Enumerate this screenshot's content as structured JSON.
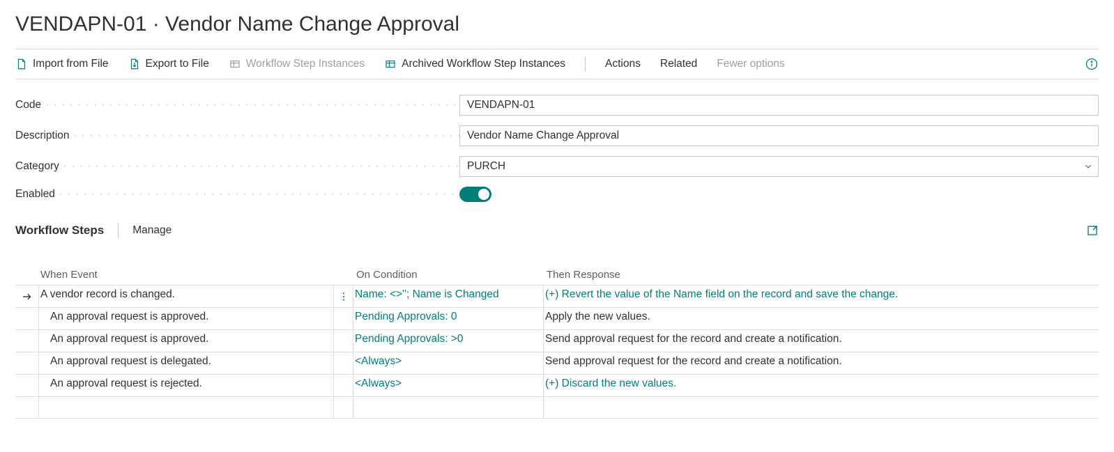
{
  "title": "VENDAPN-01 · Vendor Name Change Approval",
  "toolbar": {
    "importFromFile": "Import from File",
    "exportToFile": "Export to File",
    "workflowStepInstances": "Workflow Step Instances",
    "archivedWorkflowStepInstances": "Archived Workflow Step Instances",
    "actions": "Actions",
    "related": "Related",
    "fewerOptions": "Fewer options"
  },
  "form": {
    "codeLabel": "Code",
    "codeValue": "VENDAPN-01",
    "descriptionLabel": "Description",
    "descriptionValue": "Vendor Name Change Approval",
    "categoryLabel": "Category",
    "categoryValue": "PURCH",
    "enabledLabel": "Enabled",
    "enabledValue": true
  },
  "section": {
    "title": "Workflow Steps",
    "manage": "Manage"
  },
  "grid": {
    "headers": {
      "whenEvent": "When Event",
      "onCondition": "On Condition",
      "thenResponse": "Then Response"
    },
    "rows": [
      {
        "selected": true,
        "indent": 0,
        "event": "A vendor record is changed.",
        "condition": "Name: <>''; Name is Changed",
        "conditionLink": true,
        "response": "(+) Revert the value of the Name field on the record and save the change.",
        "responseLink": true,
        "showMore": true
      },
      {
        "selected": false,
        "indent": 1,
        "event": "An approval request is approved.",
        "condition": "Pending Approvals: 0",
        "conditionLink": true,
        "response": "Apply the new values.",
        "responseLink": false,
        "showMore": false
      },
      {
        "selected": false,
        "indent": 1,
        "event": "An approval request is approved.",
        "condition": "Pending Approvals: >0",
        "conditionLink": true,
        "response": "Send approval request for the record and create a notification.",
        "responseLink": false,
        "showMore": false
      },
      {
        "selected": false,
        "indent": 1,
        "event": "An approval request is delegated.",
        "condition": "<Always>",
        "conditionLink": true,
        "response": "Send approval request for the record and create a notification.",
        "responseLink": false,
        "showMore": false
      },
      {
        "selected": false,
        "indent": 1,
        "event": "An approval request is rejected.",
        "condition": "<Always>",
        "conditionLink": true,
        "response": "(+) Discard the new values.",
        "responseLink": true,
        "showMore": false
      },
      {
        "selected": false,
        "indent": 0,
        "event": "",
        "condition": "",
        "conditionLink": false,
        "response": "",
        "responseLink": false,
        "showMore": false
      }
    ]
  }
}
